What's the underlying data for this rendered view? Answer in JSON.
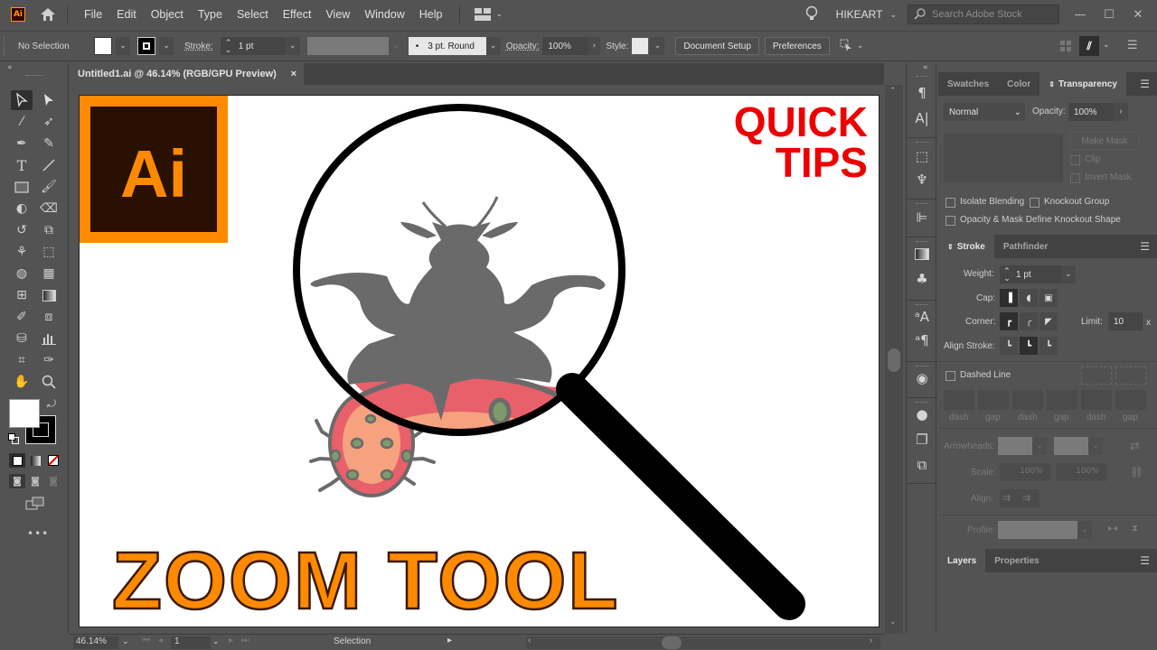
{
  "app": {
    "name": "Adobe Illustrator",
    "badge": "Ai"
  },
  "menubar": {
    "items": [
      "File",
      "Edit",
      "Object",
      "Type",
      "Select",
      "Effect",
      "View",
      "Window",
      "Help"
    ],
    "user": "HIKEART",
    "search_placeholder": "Search Adobe Stock",
    "window_controls": {
      "minimize": "—",
      "maximize": "☐",
      "close": "✕"
    }
  },
  "control_bar": {
    "selection": "No Selection",
    "stroke_label": "Stroke:",
    "stroke_value": "1 pt",
    "brush": "3 pt. Round",
    "opacity_label": "Opacity:",
    "opacity_value": "100%",
    "style_label": "Style:",
    "document_setup": "Document Setup",
    "preferences": "Preferences"
  },
  "document": {
    "tab_title": "Untitled1.ai @ 46.14% (RGB/GPU Preview)",
    "close": "×"
  },
  "artwork": {
    "logo_text": "Ai",
    "headline_line1": "QUICK",
    "headline_line2": "TIPS",
    "title": "ZOOM TOOL",
    "colors": {
      "orange": "#ff8a00",
      "logo_bg": "#2a1000",
      "red": "#ee0000",
      "bug_gray": "#6b6a6b",
      "bug_red": "#e8606a",
      "bug_peach": "#f6a27f",
      "bug_spot": "#7f9a6a"
    }
  },
  "toolbar": {
    "tools": [
      "Selection",
      "Direct Selection",
      "Magic Wand",
      "Lasso",
      "Pen",
      "Curvature",
      "Type",
      "Line Segment",
      "Rectangle",
      "Paintbrush",
      "Shaper",
      "Eraser",
      "Rotate",
      "Scale",
      "Puppet Warp",
      "Free Transform",
      "Shape Builder",
      "Perspective Grid",
      "Mesh",
      "Gradient",
      "Eyedropper",
      "Blend",
      "Symbol Sprayer",
      "Column Graph",
      "Artboard",
      "Slice",
      "Hand",
      "Zoom"
    ],
    "more": "•••"
  },
  "panels": {
    "transparency": {
      "tabs": [
        "Swatches",
        "Color",
        "Transparency"
      ],
      "active_tab": "Transparency",
      "blend_mode": "Normal",
      "opacity_label": "Opacity:",
      "opacity_value": "100%",
      "make_mask": "Make Mask",
      "clip": "Clip",
      "invert_mask": "Invert Mask",
      "isolate_blending": "Isolate Blending",
      "knockout_group": "Knockout Group",
      "opacity_mask_knockout": "Opacity & Mask Define Knockout Shape"
    },
    "stroke": {
      "tabs": [
        "Stroke",
        "Pathfinder"
      ],
      "active_tab": "Stroke",
      "weight_label": "Weight:",
      "weight_value": "1 pt",
      "cap_label": "Cap:",
      "corner_label": "Corner:",
      "limit_label": "Limit:",
      "limit_value": "10",
      "limit_unit": "x",
      "align_label": "Align Stroke:",
      "dashed_line": "Dashed Line",
      "dash_labels": [
        "dash",
        "gap",
        "dash",
        "gap",
        "dash",
        "gap"
      ],
      "arrowheads_label": "Arrowheads:",
      "scale_label": "Scale:",
      "scale_values": [
        "100%",
        "100%"
      ],
      "align_arrow_label": "Align:",
      "profile_label": "Profile:"
    },
    "layers": {
      "tabs": [
        "Layers",
        "Properties"
      ],
      "active_tab": "Layers"
    }
  },
  "statusbar": {
    "zoom": "46.14%",
    "artboard": "1",
    "tool": "Selection"
  }
}
